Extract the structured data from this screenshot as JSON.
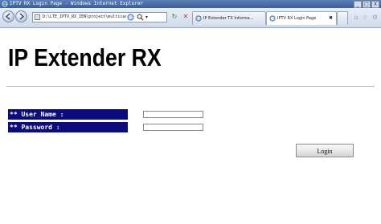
{
  "window": {
    "title": "IPTV RX Login Page - Windows Internet Explorer",
    "controls": [
      "_",
      "□",
      "X"
    ]
  },
  "address_bar": {
    "url": "D:\\LTE_IPTV_RX_IEN\\project\\multicast\\web_str",
    "dropdown": "▾"
  },
  "toolbar": {
    "refresh_symbol": "↻",
    "stop_symbol": "✕"
  },
  "tabs": [
    {
      "label": "IP Extender TX Informa...",
      "active": false
    },
    {
      "label": "IPTV RX Login Page",
      "active": true,
      "close": "✖"
    }
  ],
  "right_icons": [
    "⌂",
    "☆",
    "⚙"
  ],
  "page": {
    "heading": "IP Extender RX",
    "username_label": "** User Name :",
    "password_label": "** Password :",
    "username_value": "",
    "password_value": "",
    "login_button": "Login"
  },
  "colors": {
    "label_background": "#0b0b7e",
    "label_text": "#ffffff",
    "titlebar": "#3d5f98"
  }
}
